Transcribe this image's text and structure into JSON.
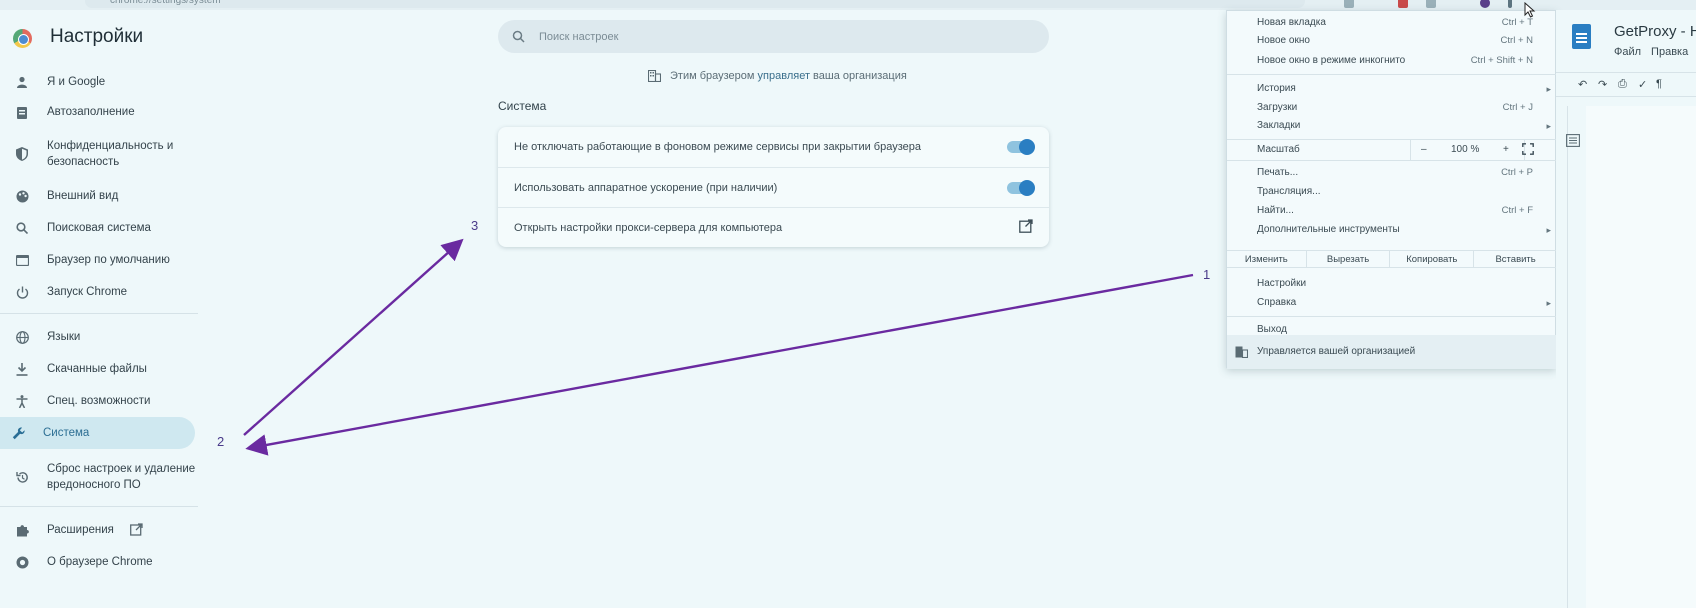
{
  "browser": {
    "url": "chrome://settings/system"
  },
  "header": {
    "title": "Настройки",
    "search_placeholder": "Поиск настроек"
  },
  "sidebar": {
    "items": [
      {
        "label": "Я и Google",
        "icon": "person-icon"
      },
      {
        "label": "Автозаполнение",
        "icon": "clipboard-icon"
      },
      {
        "label": "Конфиденциальность и безопасность",
        "icon": "shield-icon"
      },
      {
        "label": "Внешний вид",
        "icon": "palette-icon"
      },
      {
        "label": "Поисковая система",
        "icon": "search-icon"
      },
      {
        "label": "Браузер по умолчанию",
        "icon": "browser-icon"
      },
      {
        "label": "Запуск Chrome",
        "icon": "power-icon"
      },
      {
        "label": "Языки",
        "icon": "globe-icon"
      },
      {
        "label": "Скачанные файлы",
        "icon": "download-icon"
      },
      {
        "label": "Спец. возможности",
        "icon": "accessibility-icon"
      },
      {
        "label": "Система",
        "icon": "wrench-icon",
        "active": true
      },
      {
        "label": "Сброс настроек и удаление вредоносного ПО",
        "icon": "reset-icon"
      },
      {
        "label": "Расширения",
        "icon": "puzzle-icon"
      },
      {
        "label": "О браузере Chrome",
        "icon": "chrome-icon"
      }
    ]
  },
  "main": {
    "managed_text": "Этим браузером",
    "managed_link": "управляет",
    "managed_tail": "ваша организация",
    "section_title": "Система",
    "rows": [
      {
        "label": "Не отключать работающие в фоновом режиме сервисы при закрытии браузера",
        "control": "toggle",
        "on": true
      },
      {
        "label": "Использовать аппаратное ускорение (при наличии)",
        "control": "toggle",
        "on": true
      },
      {
        "label": "Открыть настройки прокси-сервера для компьютера",
        "control": "external-link-icon"
      }
    ]
  },
  "annotations": {
    "labels": [
      "1",
      "2",
      "3"
    ],
    "color": "#6a2aa0"
  },
  "menu": {
    "items_top": [
      {
        "label": "Новая вкладка",
        "shortcut": "Ctrl + T"
      },
      {
        "label": "Новое окно",
        "shortcut": "Ctrl + N"
      },
      {
        "label": "Новое окно в режиме инкогнито",
        "shortcut": "Ctrl + Shift + N"
      }
    ],
    "items_history": [
      {
        "label": "История",
        "submenu": true
      },
      {
        "label": "Загрузки",
        "shortcut": "Ctrl + J"
      },
      {
        "label": "Закладки",
        "submenu": true
      }
    ],
    "zoom_label": "Масштаб",
    "zoom_minus": "–",
    "zoom_value": "100 %",
    "zoom_plus": "+",
    "items_tools": [
      {
        "label": "Печать...",
        "shortcut": "Ctrl + P"
      },
      {
        "label": "Трансляция..."
      },
      {
        "label": "Найти...",
        "shortcut": "Ctrl + F"
      },
      {
        "label": "Дополнительные инструменты",
        "submenu": true
      }
    ],
    "edit": [
      "Изменить",
      "Вырезать",
      "Копировать",
      "Вставить"
    ],
    "items_settings": [
      {
        "label": "Настройки"
      },
      {
        "label": "Справка",
        "submenu": true
      }
    ],
    "exit": "Выход",
    "managed": "Управляется вашей организацией"
  },
  "docs_pane": {
    "title": "GetProxy - H",
    "menu": [
      "Файл",
      "Правка"
    ]
  }
}
